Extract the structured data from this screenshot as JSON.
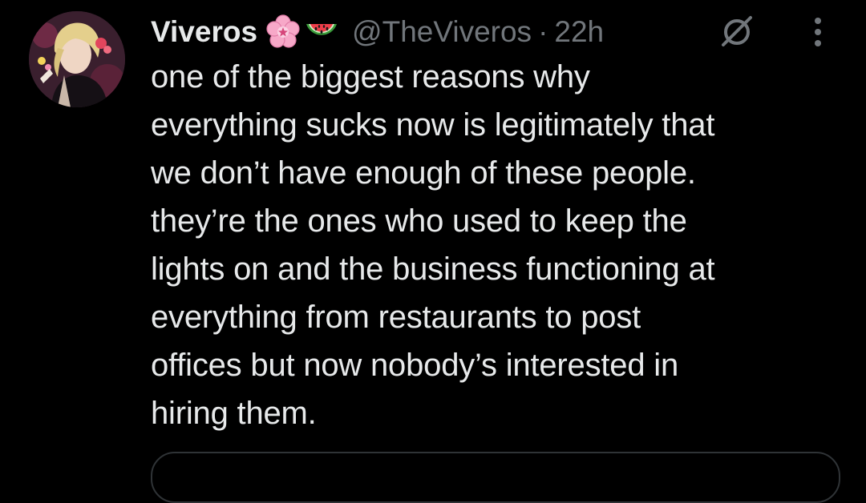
{
  "tweet": {
    "display_name": "Viveros",
    "name_emojis": [
      "cherry-blossom-icon",
      "watermelon-icon"
    ],
    "handle": "@TheViveros",
    "separator": "·",
    "timestamp": "22h",
    "text": "one of the biggest reasons why\neverything sucks now is legitimately that\nwe don’t have enough of these people.\nthey’re the ones who used to keep the\nlights on and the business functioning at\neverything from restaurants to post\noffices but now nobody’s interested in\nhiring them."
  },
  "icons": {
    "mute": "mute-icon",
    "more": "more-options-icon"
  },
  "colors": {
    "background": "#000000",
    "primary_text": "#e7e9ea",
    "secondary_text": "#71767b",
    "border": "#2f3336"
  }
}
